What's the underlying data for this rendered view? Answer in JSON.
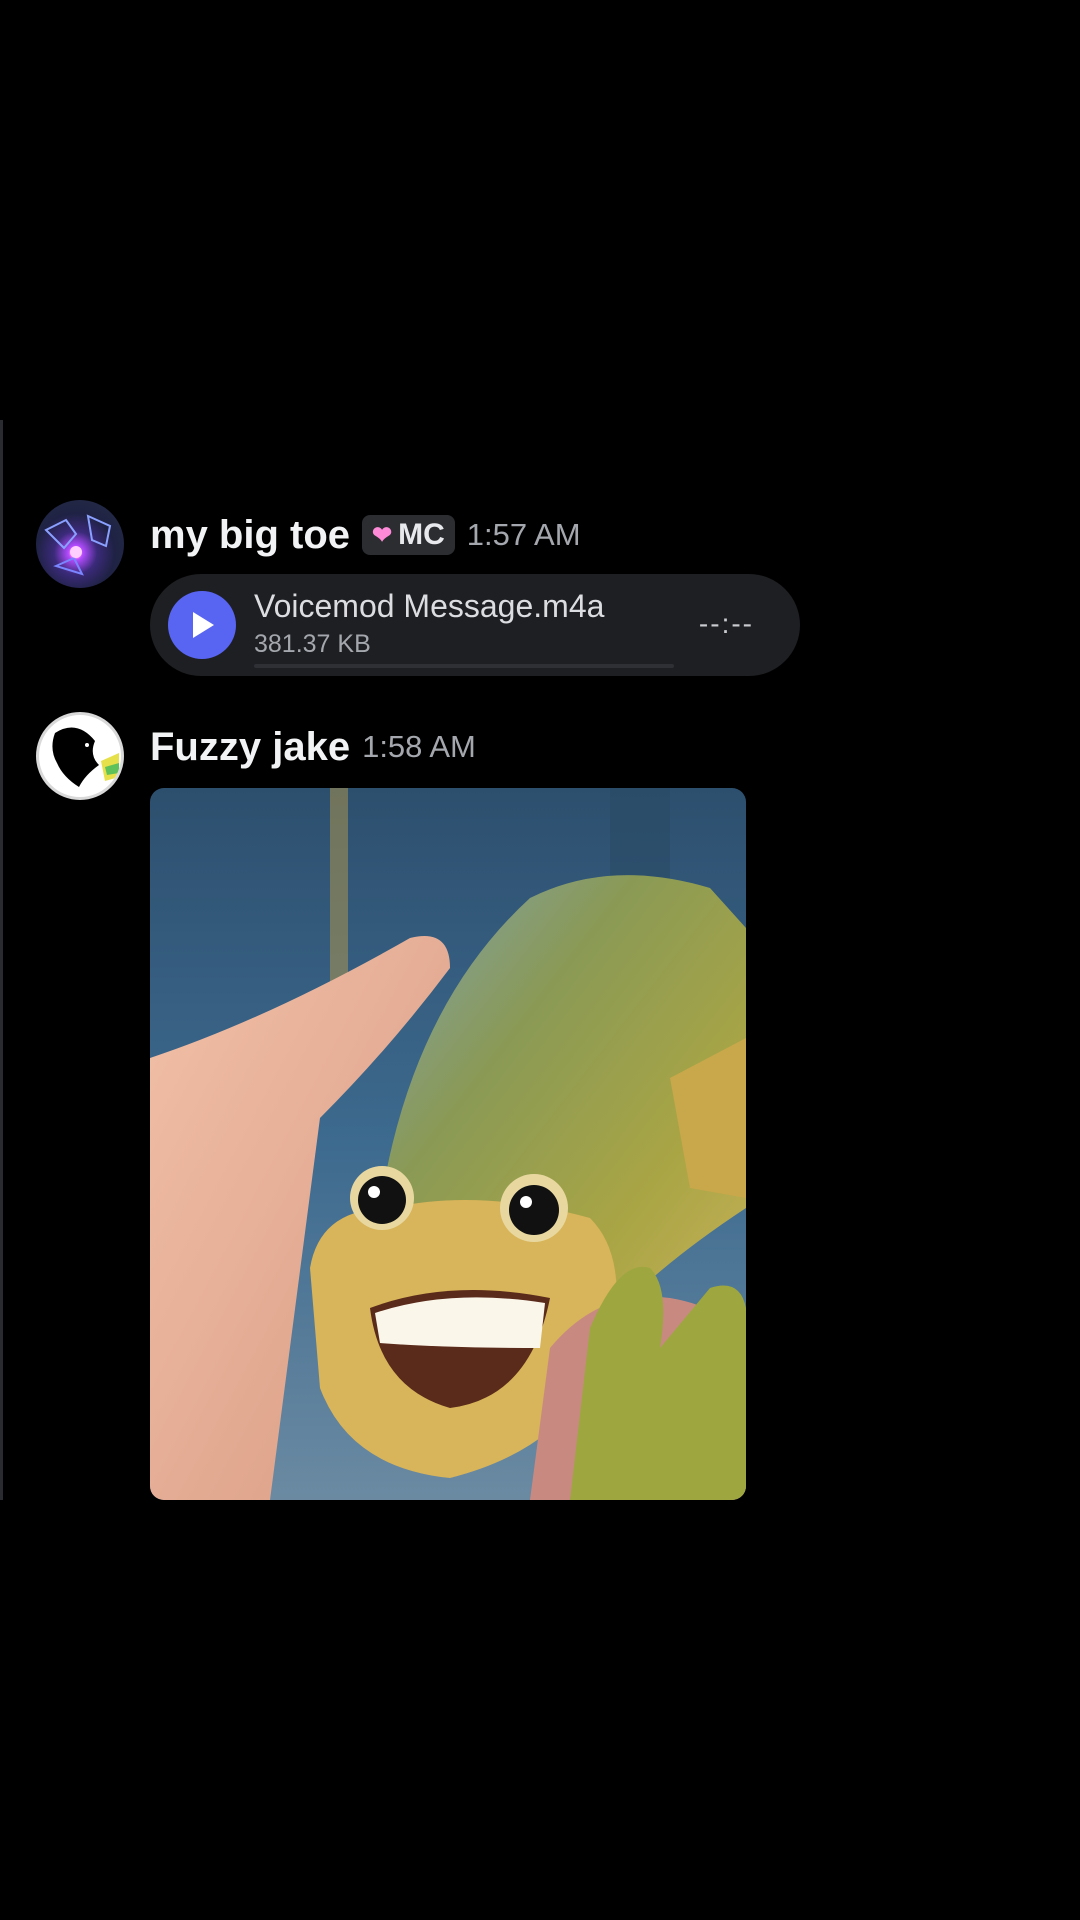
{
  "messages": [
    {
      "username": "my big toe",
      "tag": {
        "icon": "heart-icon",
        "label": "MC"
      },
      "timestamp": "1:57 AM",
      "attachment": {
        "type": "audio",
        "file_name": "Voicemod Message.m4a",
        "file_size": "381.37 KB",
        "duration": "--:--",
        "progress": 0
      }
    },
    {
      "username": "Fuzzy jake",
      "timestamp": "1:58 AM",
      "attachment": {
        "type": "image"
      }
    }
  ],
  "colors": {
    "background": "#000000",
    "accent": "#5865f2",
    "card": "#1e1f22",
    "muted_text": "#a4a7ad"
  }
}
